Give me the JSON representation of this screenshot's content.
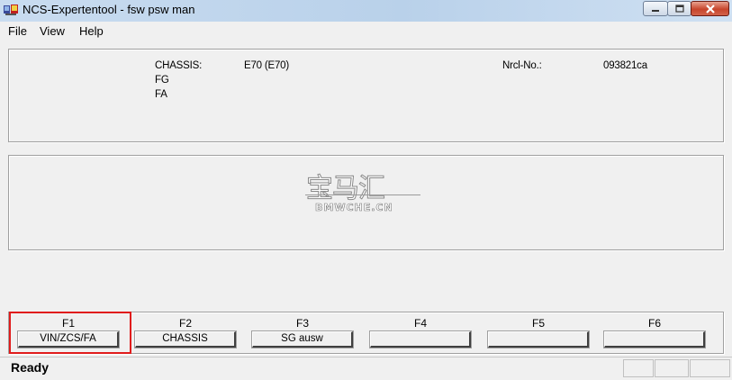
{
  "window": {
    "title": "NCS-Expertentool - fsw psw man",
    "app_icon": "ncs-app-icon",
    "controls": [
      "minimize-icon",
      "maximize-icon",
      "close-icon"
    ]
  },
  "menu": {
    "items": [
      "File",
      "View",
      "Help"
    ]
  },
  "info_panel": {
    "chassis_label": "CHASSIS:",
    "chassis_value": "E70 (E70)",
    "fg_label": "FG",
    "fa_label": "FA",
    "nrcl_label": "Nrcl-No.:",
    "nrcl_value": "093821ca"
  },
  "watermark": {
    "main": "宝马汇",
    "sub": "BMWCHE.CN"
  },
  "function_keys": [
    {
      "key": "F1",
      "label": "VIN/ZCS/FA",
      "highlighted": true
    },
    {
      "key": "F2",
      "label": "CHASSIS",
      "highlighted": false
    },
    {
      "key": "F3",
      "label": "SG ausw",
      "highlighted": false
    },
    {
      "key": "F4",
      "label": "",
      "highlighted": false
    },
    {
      "key": "F5",
      "label": "",
      "highlighted": false
    },
    {
      "key": "F6",
      "label": "",
      "highlighted": false
    }
  ],
  "colors": {
    "highlight": "#e01b1b",
    "titlebar": "#b9d1ea",
    "close_button": "#c7452c"
  },
  "status": {
    "text": "Ready"
  }
}
